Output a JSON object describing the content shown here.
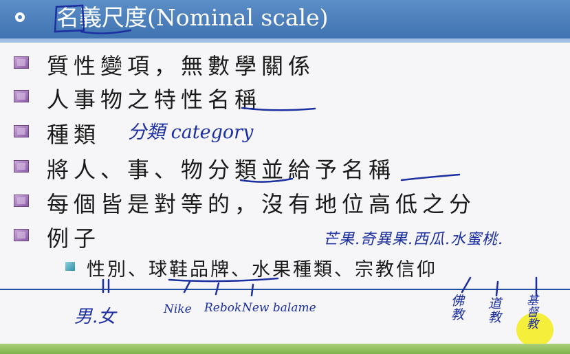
{
  "title": {
    "text": "名義尺度(Nominal scale)"
  },
  "bullets": [
    {
      "text": "質性變項，無數學關係"
    },
    {
      "text": "人事物之特性名稱"
    },
    {
      "text": "種類"
    },
    {
      "text": "將人、事、物分類並給予名稱"
    },
    {
      "text": "每個皆是對等的，沒有地位高低之分"
    },
    {
      "text": "例子"
    }
  ],
  "sub_bullet": {
    "text": "性別、球鞋品牌、水果種類、宗教信仰"
  },
  "annotations": {
    "category": "分類 category",
    "fruits": "芒果.奇異果.西瓜.水蜜桃.",
    "gender": "男.女",
    "nike": "Nike",
    "reebok": "Rebok",
    "newbalance": "New balame",
    "religion_1": "佛教",
    "religion_2": "道教",
    "religion_3": "基督教"
  },
  "colors": {
    "title_bar": "#4a7dbb",
    "bullet_icon": "#8b5ca5",
    "ink": "#1c2fa0",
    "footer": "#8fbf5a",
    "highlight": "#f5ee3a"
  }
}
